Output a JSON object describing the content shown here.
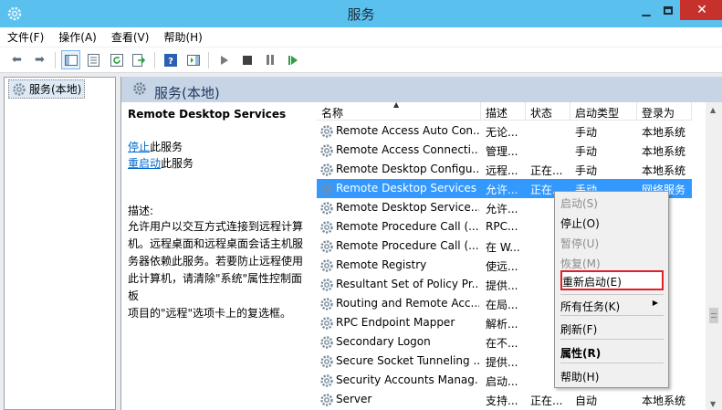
{
  "window": {
    "title": "服务"
  },
  "menubar": [
    "文件(F)",
    "操作(A)",
    "查看(V)",
    "帮助(H)"
  ],
  "tree": {
    "root_label": "服务(本地)"
  },
  "pane": {
    "title": "服务(本地)",
    "service_name": "Remote Desktop Services",
    "stop_link": "停止",
    "stop_suffix": "此服务",
    "restart_link": "重启动",
    "restart_suffix": "此服务",
    "description_label": "描述:",
    "description_lines": [
      "允许用户以交互方式连接到远程计算",
      "机。远程桌面和远程桌面会话主机服",
      "务器依赖此服务。若要防止远程使用",
      "此计算机，请清除\"系统\"属性控制面板",
      "项目的\"远程\"选项卡上的复选框。"
    ]
  },
  "columns": [
    "名称",
    "描述",
    "状态",
    "启动类型",
    "登录为"
  ],
  "rows": [
    {
      "name": "Remote Access Auto Con...",
      "desc": "无论...",
      "status": "",
      "startup": "手动",
      "logon": "本地系统"
    },
    {
      "name": "Remote Access Connecti...",
      "desc": "管理...",
      "status": "",
      "startup": "手动",
      "logon": "本地系统"
    },
    {
      "name": "Remote Desktop Configu...",
      "desc": "远程...",
      "status": "正在...",
      "startup": "手动",
      "logon": "本地系统"
    },
    {
      "name": "Remote Desktop Services",
      "desc": "允许...",
      "status": "正在...",
      "startup": "手动",
      "logon": "网络服务"
    },
    {
      "name": "Remote Desktop Service...",
      "desc": "允许...",
      "status": "",
      "startup": "",
      "logon": ""
    },
    {
      "name": "Remote Procedure Call (...",
      "desc": "RPC...",
      "status": "",
      "startup": "",
      "logon": ""
    },
    {
      "name": "Remote Procedure Call (...",
      "desc": "在 W...",
      "status": "",
      "startup": "",
      "logon": ""
    },
    {
      "name": "Remote Registry",
      "desc": "使远...",
      "status": "",
      "startup": "",
      "logon": ""
    },
    {
      "name": "Resultant Set of Policy Pr...",
      "desc": "提供...",
      "status": "",
      "startup": "",
      "logon": ""
    },
    {
      "name": "Routing and Remote Acc...",
      "desc": "在局...",
      "status": "",
      "startup": "",
      "logon": ""
    },
    {
      "name": "RPC Endpoint Mapper",
      "desc": "解析...",
      "status": "",
      "startup": "",
      "logon": ""
    },
    {
      "name": "Secondary Logon",
      "desc": "在不...",
      "status": "",
      "startup": "",
      "logon": ""
    },
    {
      "name": "Secure Socket Tunneling ...",
      "desc": "提供...",
      "status": "",
      "startup": "",
      "logon": ""
    },
    {
      "name": "Security Accounts Manag...",
      "desc": "启动...",
      "status": "",
      "startup": "",
      "logon": ""
    },
    {
      "name": "Server",
      "desc": "支持...",
      "status": "正在...",
      "startup": "自动",
      "logon": "本地系统"
    }
  ],
  "context_menu": [
    {
      "label": "启动(S)",
      "disabled": true
    },
    {
      "label": "停止(O)",
      "disabled": false
    },
    {
      "label": "暂停(U)",
      "disabled": true
    },
    {
      "label": "恢复(M)",
      "disabled": true
    },
    {
      "label": "重新启动(E)",
      "disabled": false,
      "highlighted": true
    },
    {
      "label": "所有任务(K)",
      "disabled": false,
      "submenu": true
    },
    {
      "label": "刷新(F)",
      "disabled": false
    },
    {
      "label": "属性(R)",
      "disabled": false,
      "bold": true
    },
    {
      "label": "帮助(H)",
      "disabled": false
    }
  ],
  "colors": {
    "titlebar": "#5ac1ef",
    "close_button": "#c7312b",
    "selection": "#3399ff",
    "link": "#0066cc",
    "highlight_border": "#e01f26"
  }
}
